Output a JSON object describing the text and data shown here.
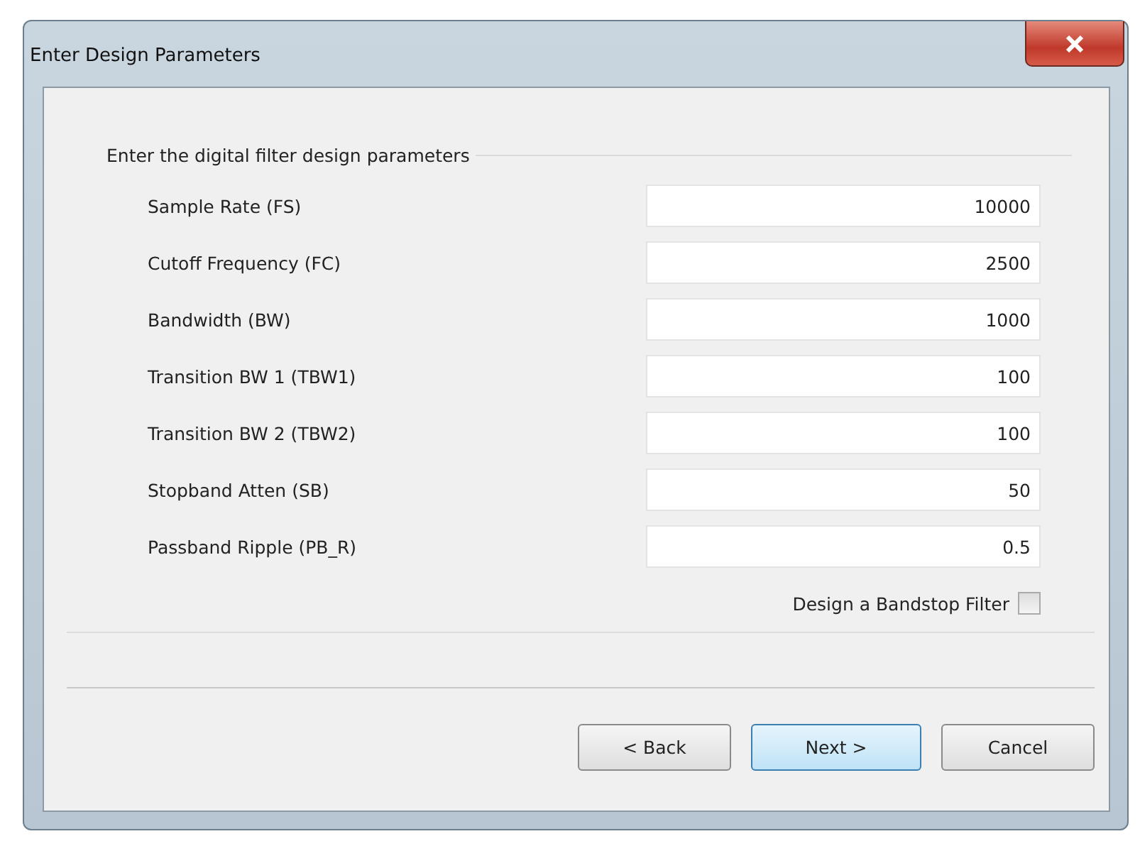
{
  "window": {
    "title": "Enter Design Parameters"
  },
  "group": {
    "title": "Enter the digital filter design parameters"
  },
  "fields": [
    {
      "label": "Sample Rate (FS)",
      "value": "10000"
    },
    {
      "label": "Cutoff Frequency (FC)",
      "value": "2500"
    },
    {
      "label": "Bandwidth (BW)",
      "value": "1000"
    },
    {
      "label": "Transition BW 1 (TBW1)",
      "value": "100"
    },
    {
      "label": "Transition BW 2 (TBW2)",
      "value": "100"
    },
    {
      "label": "Stopband Atten (SB)",
      "value": "50"
    },
    {
      "label": "Passband Ripple (PB_R)",
      "value": "0.5"
    }
  ],
  "bandstop": {
    "label": "Design a Bandstop Filter",
    "checked": false
  },
  "buttons": [
    {
      "label": "< Back",
      "default": false
    },
    {
      "label": "Next >",
      "default": true
    },
    {
      "label": "Cancel",
      "default": false
    }
  ]
}
